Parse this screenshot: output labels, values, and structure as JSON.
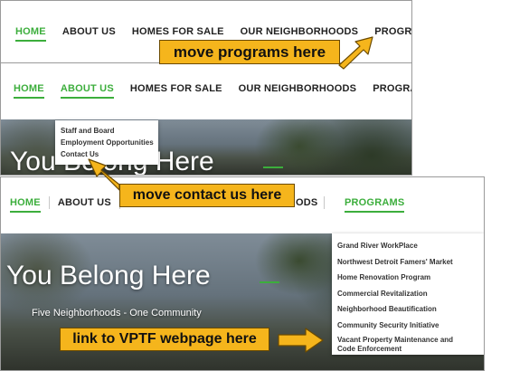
{
  "panel1": {
    "nav": [
      {
        "label": "HOME",
        "active": true
      },
      {
        "label": "ABOUT US",
        "active": false
      },
      {
        "label": "HOMES FOR SALE",
        "active": false
      },
      {
        "label": "OUR NEIGHBORHOODS",
        "active": false
      },
      {
        "label": "PROGRAMS",
        "active": false
      }
    ],
    "callout": "move programs here"
  },
  "panel2": {
    "nav": [
      {
        "label": "HOME",
        "active": true
      },
      {
        "label": "ABOUT US",
        "active": true
      },
      {
        "label": "HOMES FOR SALE",
        "active": false
      },
      {
        "label": "OUR NEIGHBORHOODS",
        "active": false
      },
      {
        "label": "PROGRAMS",
        "active": false
      }
    ],
    "dropdown": [
      "Staff and Board",
      "Employment Opportunities",
      "Contact Us"
    ],
    "hero_title": "You Belong Here",
    "callout": "move contact us here"
  },
  "panel3": {
    "nav": [
      {
        "label": "HOME",
        "active": true
      },
      {
        "label": "ABOUT US",
        "active": false
      },
      {
        "label": "ODS",
        "active": false
      },
      {
        "label": "PROGRAMS",
        "active": true
      }
    ],
    "dropdown": [
      "Grand River WorkPlace",
      "Northwest Detroit Famers' Market",
      "Home Renovation Program",
      "Commercial Revitalization",
      "Neighborhood Beautification",
      "Community Security Initiative",
      "Vacant Property Maintenance and Code Enforcement"
    ],
    "hero_title": "You Belong Here",
    "hero_subtitle": "Five Neighborhoods - One Community",
    "callout": "link to VPTF webpage here"
  },
  "colors": {
    "accent": "#3cae3c",
    "callout": "#f5b51c"
  }
}
